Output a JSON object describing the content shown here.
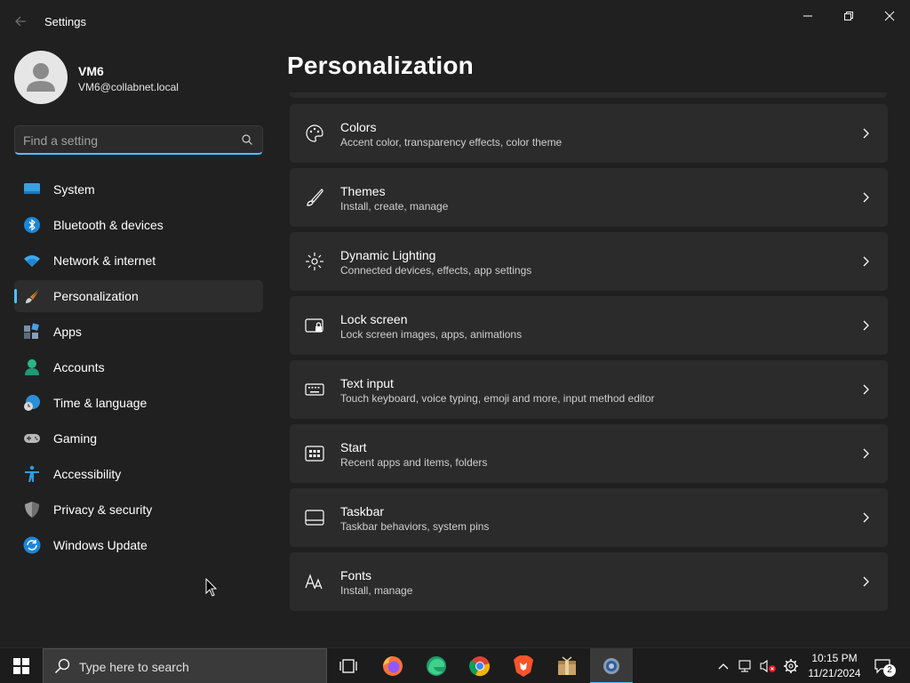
{
  "window": {
    "title": "Settings"
  },
  "profile": {
    "name": "VM6",
    "email": "VM6@collabnet.local"
  },
  "search": {
    "placeholder": "Find a setting"
  },
  "sidebar": {
    "items": [
      {
        "label": "System",
        "icon": "monitor-icon"
      },
      {
        "label": "Bluetooth & devices",
        "icon": "bluetooth-icon"
      },
      {
        "label": "Network & internet",
        "icon": "wifi-icon"
      },
      {
        "label": "Personalization",
        "icon": "brush-icon",
        "selected": true
      },
      {
        "label": "Apps",
        "icon": "apps-icon"
      },
      {
        "label": "Accounts",
        "icon": "person-icon"
      },
      {
        "label": "Time & language",
        "icon": "globe-clock-icon"
      },
      {
        "label": "Gaming",
        "icon": "gamepad-icon"
      },
      {
        "label": "Accessibility",
        "icon": "accessibility-icon"
      },
      {
        "label": "Privacy & security",
        "icon": "shield-icon"
      },
      {
        "label": "Windows Update",
        "icon": "update-icon"
      }
    ]
  },
  "main": {
    "title": "Personalization",
    "cards": [
      {
        "title": "Colors",
        "desc": "Accent color, transparency effects, color theme",
        "icon": "palette-icon"
      },
      {
        "title": "Themes",
        "desc": "Install, create, manage",
        "icon": "brush-icon"
      },
      {
        "title": "Dynamic Lighting",
        "desc": "Connected devices, effects, app settings",
        "icon": "lighting-icon"
      },
      {
        "title": "Lock screen",
        "desc": "Lock screen images, apps, animations",
        "icon": "lock-screen-icon"
      },
      {
        "title": "Text input",
        "desc": "Touch keyboard, voice typing, emoji and more, input method editor",
        "icon": "keyboard-icon"
      },
      {
        "title": "Start",
        "desc": "Recent apps and items, folders",
        "icon": "start-icon"
      },
      {
        "title": "Taskbar",
        "desc": "Taskbar behaviors, system pins",
        "icon": "taskbar-icon"
      },
      {
        "title": "Fonts",
        "desc": "Install, manage",
        "icon": "fonts-icon"
      }
    ]
  },
  "taskbar": {
    "search_text": "Type here to search",
    "time": "10:15 PM",
    "date": "11/21/2024",
    "notification_count": "2"
  },
  "colors": {
    "accent": "#4cc2ff",
    "background": "#202020",
    "card": "#2b2b2b"
  }
}
